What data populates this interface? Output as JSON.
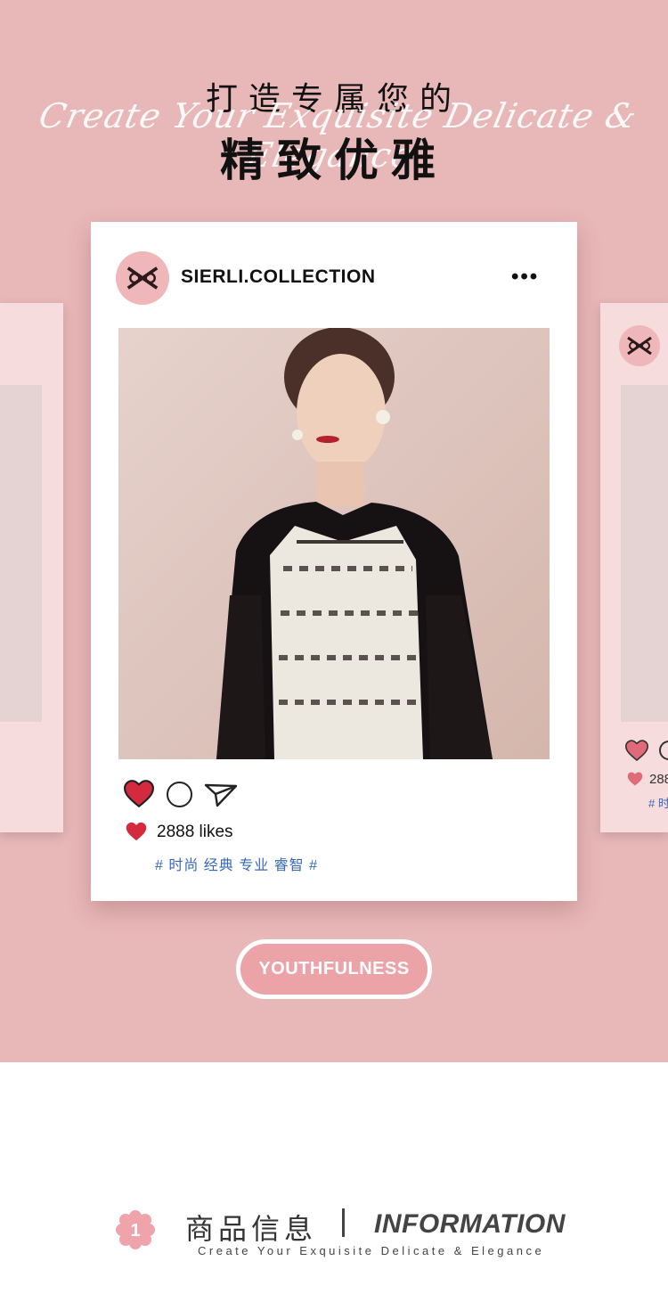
{
  "header": {
    "title_line1": "打造专属您的",
    "title_script": "Create Your Exquisite Delicate & Elegance",
    "title_line2": "精致优雅"
  },
  "post": {
    "username": "SIERLI.COLLECTION",
    "more_label": "•••",
    "likes": "2888 likes",
    "tags": "# 时尚 经典 专业 睿智 #",
    "heart_color": "#d32a3e"
  },
  "side_posts": {
    "likes_partial": "288",
    "tags_partial": "# 时"
  },
  "badge": {
    "label": "YOUTHFULNESS"
  },
  "info_section": {
    "number": "1",
    "title_cn": "商品信息",
    "title_en": "INFORMATION",
    "subtitle": "Create Your Exquisite Delicate & Elegance"
  },
  "colors": {
    "background_pink": "#e8b7b8",
    "side_card": "#f6dcdd",
    "tag_blue": "#3768b8",
    "badge_pink": "#eca3a8"
  },
  "icons": [
    "brand-logo-icon",
    "more-options-icon",
    "heart-icon",
    "comment-icon",
    "share-icon",
    "number-badge-icon"
  ]
}
